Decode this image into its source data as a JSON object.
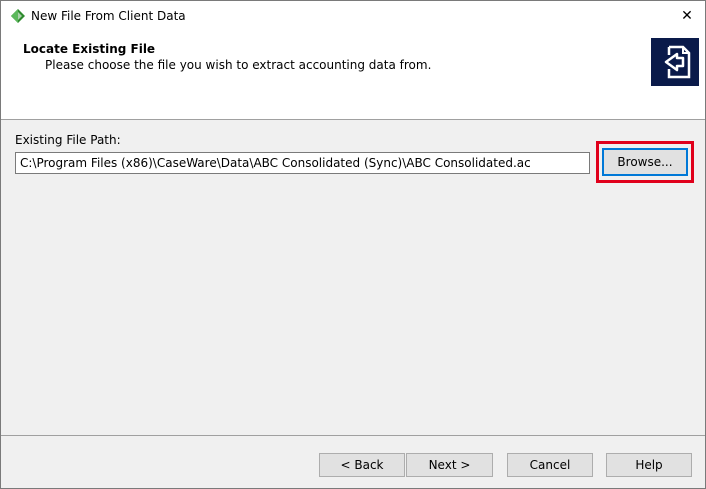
{
  "window": {
    "title": "New File From Client Data",
    "close_symbol": "✕",
    "app_icon": "caseware-app-icon"
  },
  "header": {
    "title": "Locate Existing File",
    "subtitle": "Please choose the file you wish to extract accounting data from.",
    "icon": "file-arrow-icon"
  },
  "form": {
    "path_label": "Existing File Path:",
    "path_value": "C:\\Program Files (x86)\\CaseWare\\Data\\ABC Consolidated (Sync)\\ABC Consolidated.ac",
    "browse_label": "Browse..."
  },
  "footer": {
    "back_label": "< Back",
    "next_label": "Next >",
    "cancel_label": "Cancel",
    "help_label": "Help"
  },
  "colors": {
    "highlight": "#e0001b",
    "focus_border": "#0078d7",
    "header_icon_bg": "#0a1a4a"
  }
}
